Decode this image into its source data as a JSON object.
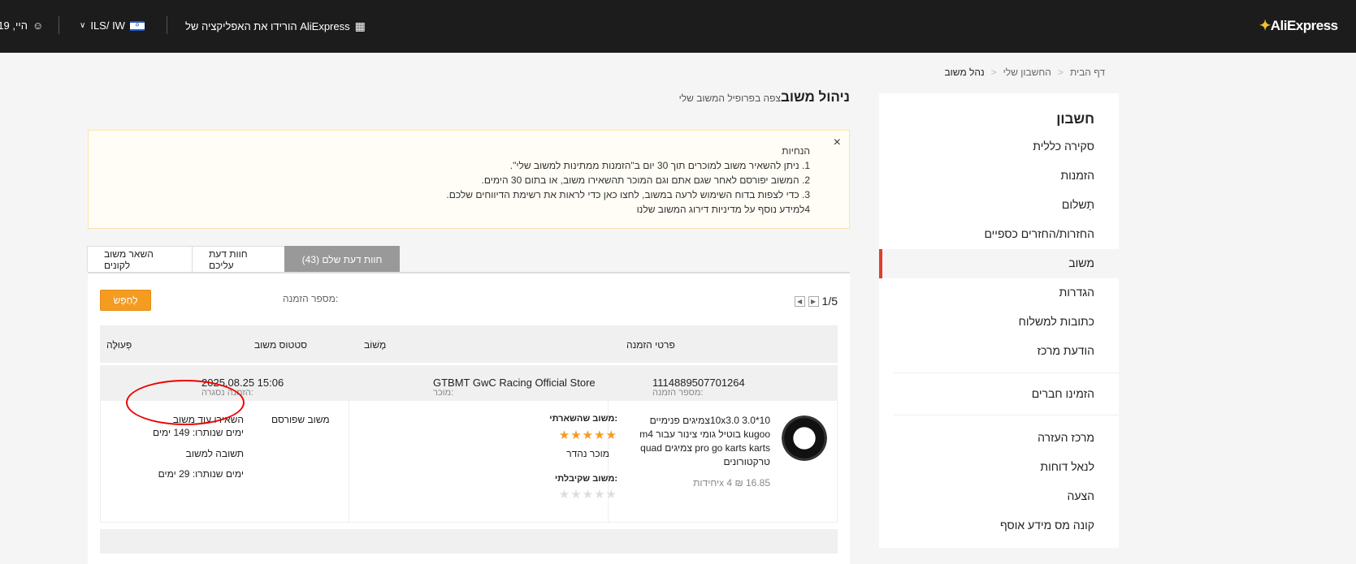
{
  "topbar": {
    "logo": "AliExpress",
    "app_download": "הורידו את האפליקציה של AliExpress",
    "currency": "ILS/ IW",
    "greeting": "היי, 19"
  },
  "breadcrumb": [
    "דף הבית",
    "החשבון שלי",
    "נהל משוב"
  ],
  "sidebar": {
    "title": "חשבון",
    "items": [
      "סקירה כללית",
      "הזמנות",
      "תַשלום",
      "החזרות/החזרים כספיים",
      "משוב",
      "הגדרות",
      "כתובות למשלוח",
      "הודעת מרכז",
      "הזמינו חברים",
      "מרכז העזרה",
      "לנאל דוחות",
      "הצעה",
      "קונה מס מידע אוסף"
    ]
  },
  "page": {
    "title": "ניהול משוב",
    "hint": "צפה בפרופיל המשוב שלי"
  },
  "notice": {
    "heading": "הנחיות",
    "lines": [
      "1. ניתן להשאיר משוב למוכרים תוך 30 יום ב\"הזמנות ממתינות למשוב שלי\".",
      "2. המשוב יפורסם לאחר שגם אתם וגם המוכר תהשאירו משוב, או בתום 30 הימים.",
      "3. כדי לצפות בדוח השימוש לרעה במשוב, לחצו כאן כדי לראות את רשימת הדיווחים שלכם.",
      "4למידע נוסף על מדיניות דירוג המשוב שלנו"
    ],
    "close": "×"
  },
  "tabs": [
    "חוות דעת שלם (43)",
    "חוות דעת עליכם",
    "השאר משוב לקונים"
  ],
  "search": {
    "button": "לְחַפֵּשׂ",
    "order_label": "מספר הזמנה:"
  },
  "pager": {
    "text": "1/5",
    "prev": "◀",
    "next": "▶"
  },
  "table": {
    "headers": {
      "details": "פרטי הזמנה",
      "feedback": "מָשׁוֹב",
      "status": "סטטוס משוב",
      "action": "פְּעוּלָּה"
    },
    "order": {
      "order_no_label": "מספר הזמנה:",
      "order_no": "1114889507701264",
      "seller_label": "מוכר:",
      "seller": "GTBMT GwC Racing Official Store",
      "closed_label": "הזמנה נסגרה:",
      "closed": "2025.08.25 15:06"
    },
    "item": {
      "name": "10x3.0 3.0*10צמיגים פנימיים kugoo בוטיל גומי צינור עבור m4 pro go karts karts צמיגים quad טרקטורונים",
      "price": "16.85 ₪ x 4יחידות",
      "left_label": "משוב שהשארתי:",
      "left_stars": "★★★★★",
      "left_text": "מוכר נהדר",
      "received_label": "משוב שקיבלתי:",
      "received_stars": "★★★★★",
      "status": "משוב שפורסם",
      "action1": "השאירו עוד משוב",
      "days1": "ימים שנותרו: 149 ימים",
      "action2": "תשובה למשוב",
      "days2": "ימים שנותרו: 29 ימים"
    }
  },
  "colors": {
    "accent": "#f49b20",
    "active_bar": "#e03e2d",
    "stars": "#f49b20",
    "annotation": "#e00000"
  }
}
